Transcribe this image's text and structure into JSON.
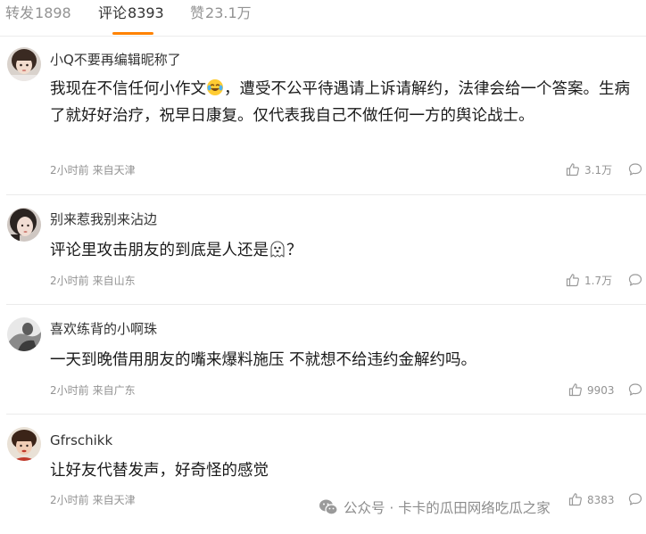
{
  "tabs": [
    {
      "label": "转发",
      "count": "1898",
      "active": false
    },
    {
      "label": "评论",
      "count": "8393",
      "active": true
    },
    {
      "label": "赞",
      "count": "23.1万",
      "active": false
    }
  ],
  "accent_color": "#ff8200",
  "comments": [
    {
      "username": "小Q不要再编辑昵称了",
      "text_before_emoji": "我现在不信任何小作文",
      "emoji": "laughing-crying-emoji",
      "text_after_emoji": "，遭受不公平待遇请上诉请解约，法律会给一个答案。生病了就好好治疗，祝早日康复。仅代表我自己不做任何一方的舆论战士。",
      "time": "2小时前",
      "location": "来自天津",
      "likes": "3.1万"
    },
    {
      "username": "别来惹我别来沾边",
      "text_before_emoji": "评论里攻击朋友的到底是人还是",
      "emoji": "ghost-emoji",
      "text_after_emoji": "？",
      "time": "2小时前",
      "location": "来自山东",
      "likes": "1.7万"
    },
    {
      "username": "喜欢练背的小啊珠",
      "text": "一天到晚借用朋友的嘴来爆料施压 不就想不给违约金解约吗。",
      "time": "2小时前",
      "location": "来自广东",
      "likes": "9903"
    },
    {
      "username": "Gfrschikk",
      "text": "让好友代替发声，好奇怪的感觉",
      "time": "2小时前",
      "location": "来自天津",
      "likes": "8383"
    }
  ],
  "watermark": "公众号 · 卡卡的瓜田网络吃瓜之家"
}
